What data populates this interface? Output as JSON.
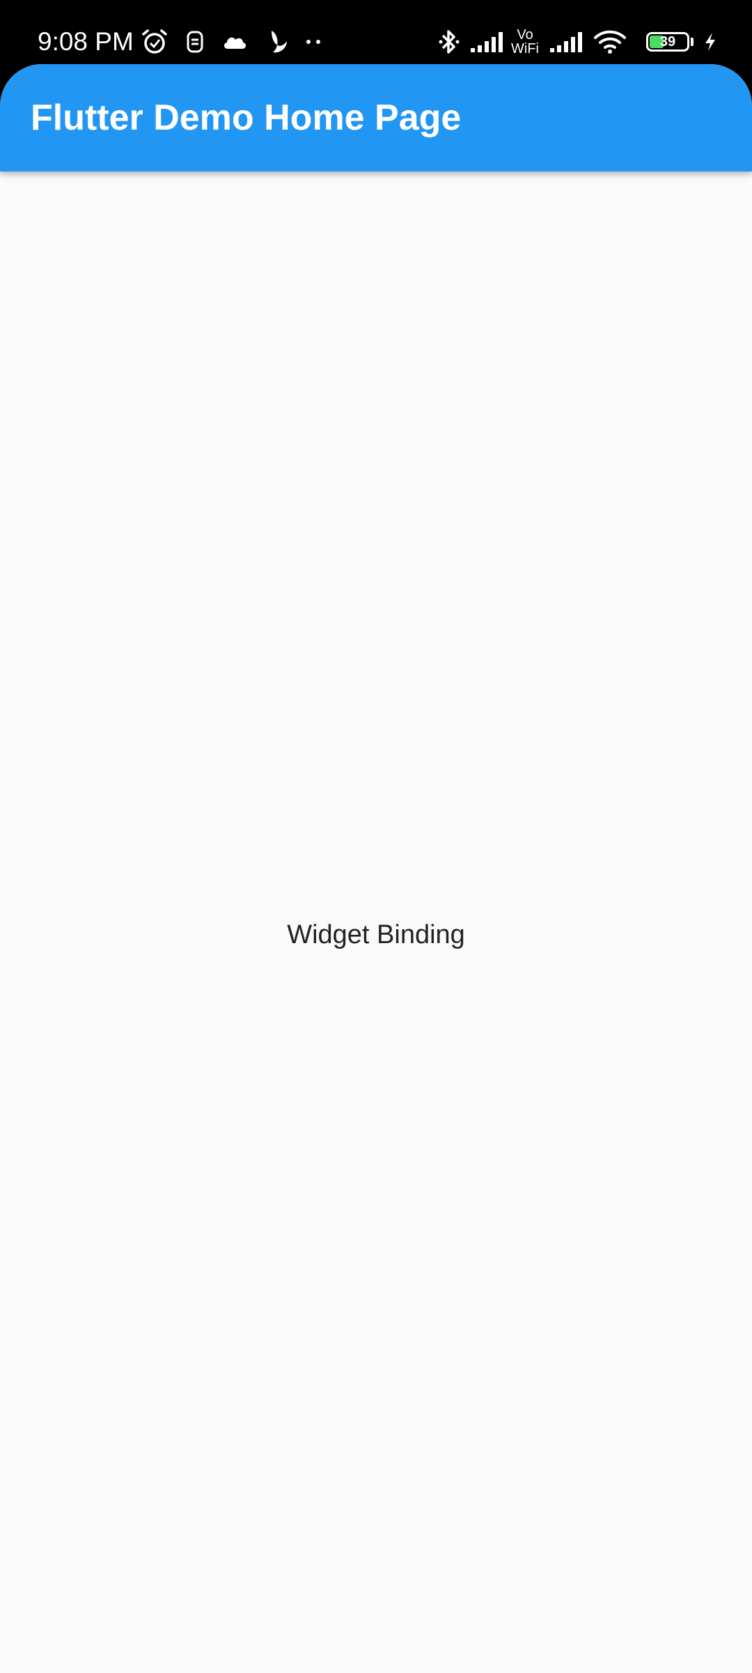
{
  "status_bar": {
    "time": "9:08 PM",
    "left_icons": [
      "alarm-icon",
      "sim-toolkit-icon",
      "cloud-icon",
      "do-not-disturb-moon-icon",
      "more-notifications-icon"
    ],
    "right_icons": [
      "bluetooth-icon",
      "signal-strength-icon",
      "vowifi-icon",
      "signal-strength-2-icon",
      "wifi-icon",
      "battery-icon",
      "charging-bolt-icon"
    ],
    "vowifi_line1": "Vo",
    "vowifi_line2": "WiFi",
    "battery_level": "39",
    "battery_fill_percent": 39,
    "battery_color": "#4cd964"
  },
  "app_bar": {
    "title": "Flutter Demo Home Page",
    "color": "#2196f3"
  },
  "body": {
    "center_text": "Widget Binding",
    "background": "#fafafa"
  }
}
